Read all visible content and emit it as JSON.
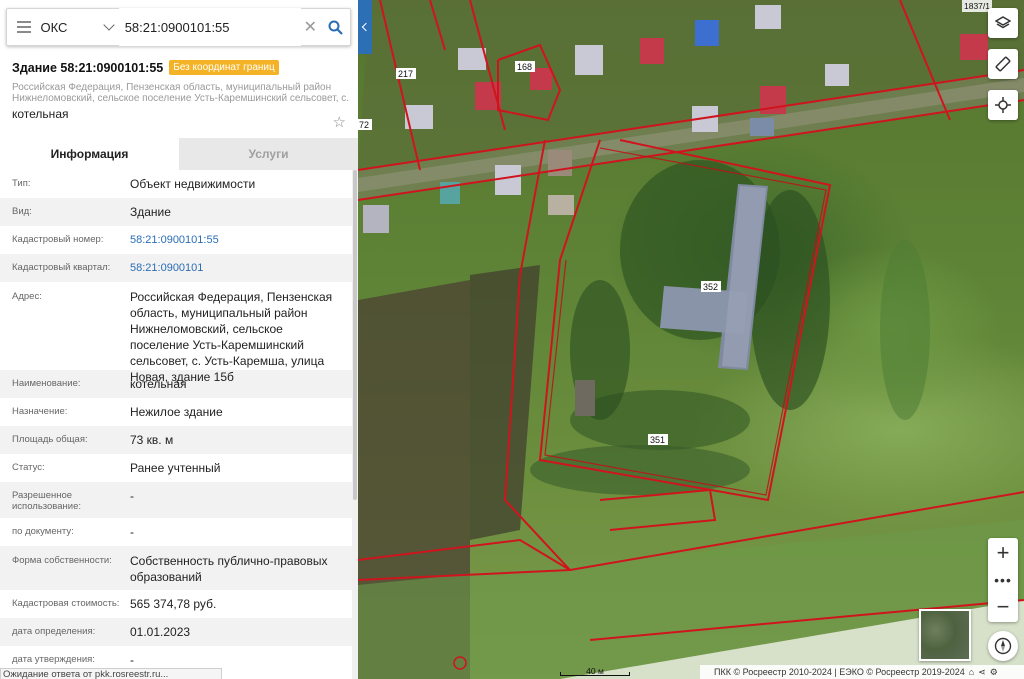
{
  "search": {
    "type_value": "ОКС",
    "query": "58:21:0900101:55"
  },
  "object": {
    "title": "Здание 58:21:0900101:55",
    "badge": "Без координат границ",
    "address_short": "Российская Федерация, Пензенская область, муниципальный район Нижнеломовский, сельское поселение Усть-Каремшинский сельсовет, с. Усть-...",
    "name": "котельная"
  },
  "tabs": [
    {
      "label": "Информация",
      "active": true
    },
    {
      "label": "Услуги",
      "active": false
    }
  ],
  "properties": [
    {
      "label": "Тип:",
      "value": "Объект недвижимости",
      "link": false
    },
    {
      "label": "Вид:",
      "value": "Здание",
      "link": false
    },
    {
      "label": "Кадастровый номер:",
      "value": "58:21:0900101:55",
      "link": true
    },
    {
      "label": "Кадастровый квартал:",
      "value": "58:21:0900101",
      "link": true
    },
    {
      "label": "Адрес:",
      "value": "Российская Федерация, Пензенская область, муниципальный район Нижнеломовский, сельское поселение Усть-Каремшинский сельсовет, с. Усть-Каремша, улица Новая, здание 15б",
      "link": false
    },
    {
      "label": "Наименование:",
      "value": "котельная",
      "link": false
    },
    {
      "label": "Назначение:",
      "value": "Нежилое здание",
      "link": false
    },
    {
      "label": "Площадь общая:",
      "value": "73 кв. м",
      "link": false
    },
    {
      "label": "Статус:",
      "value": "Ранее учтенный",
      "link": false
    },
    {
      "label": "Разрешенное использование:",
      "value": "-",
      "link": false
    },
    {
      "label": "по документу:",
      "value": "-",
      "link": false
    },
    {
      "label": "Форма собственности:",
      "value": "Собственность публично-правовых образований",
      "link": false
    },
    {
      "label": "Кадастровая стоимость:",
      "value": "565 374,78 руб.",
      "link": false
    },
    {
      "label": "дата определения:",
      "value": "01.01.2023",
      "link": false
    },
    {
      "label": "дата утверждения:",
      "value": "-",
      "link": false
    }
  ],
  "status_text": "Ожидание ответа от pkk.rosreestr.ru...",
  "map": {
    "parcel_labels": [
      "217",
      "168",
      "352",
      "351",
      "72"
    ],
    "top_label": "1837/1",
    "scale_label": "40 м",
    "attribution": "ПКК © Росреестр 2010-2024 | ЕЭКО © Росреестр 2019-2024",
    "boundary_color": "#d0141e",
    "roof_colors": [
      "#c9c9d6",
      "#c53a4a",
      "#3d6fd0",
      "#7a8ca8"
    ]
  },
  "icons": {
    "menu": "hamburger-icon",
    "search": "search-icon",
    "clear": "close-icon",
    "layers": "layers-icon",
    "ruler": "ruler-icon",
    "locate": "crosshair-icon",
    "compass": "compass-icon",
    "star": "star-icon"
  }
}
